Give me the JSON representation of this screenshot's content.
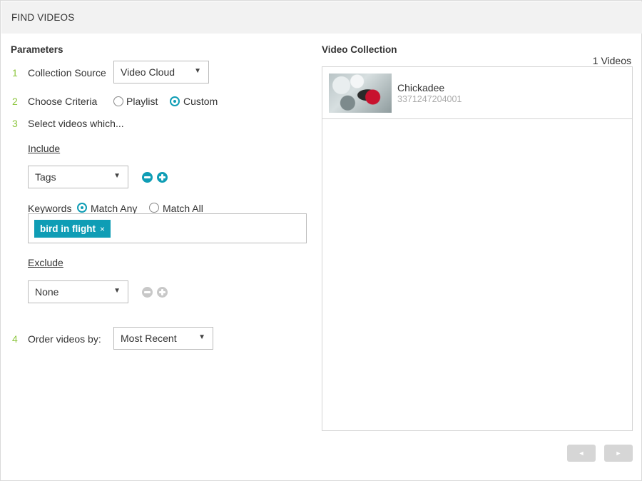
{
  "header": {
    "title": "FIND VIDEOS"
  },
  "parameters": {
    "heading": "Parameters",
    "step1": {
      "num": "1",
      "label": "Collection Source",
      "select_value": "Video Cloud"
    },
    "step2": {
      "num": "2",
      "label": "Choose Criteria",
      "options": [
        "Playlist",
        "Custom"
      ],
      "selected": "Custom"
    },
    "step3": {
      "num": "3",
      "label": "Select videos which..."
    },
    "include": {
      "label": "Include",
      "select_value": "Tags",
      "keywords_label": "Keywords",
      "match_options": [
        "Match Any",
        "Match All"
      ],
      "match_selected": "Match Any",
      "tags": [
        "bird in flight"
      ]
    },
    "exclude": {
      "label": "Exclude",
      "select_value": "None"
    },
    "step4": {
      "num": "4",
      "label": "Order videos by:",
      "select_value": "Most Recent"
    }
  },
  "collection": {
    "heading": "Video Collection",
    "count_label": "1 Videos",
    "videos": [
      {
        "title": "Chickadee",
        "id": "3371247204001"
      }
    ]
  },
  "pagination": {
    "prev_icon": "◄",
    "next_icon": "►"
  },
  "colors": {
    "accent": "#0f9db5",
    "step_number": "#8dc63f",
    "disabled": "#c8c8c8"
  },
  "icons": {
    "caret": "▼",
    "remove": "minus-circle-icon",
    "add": "plus-circle-icon",
    "chip_close": "×"
  }
}
